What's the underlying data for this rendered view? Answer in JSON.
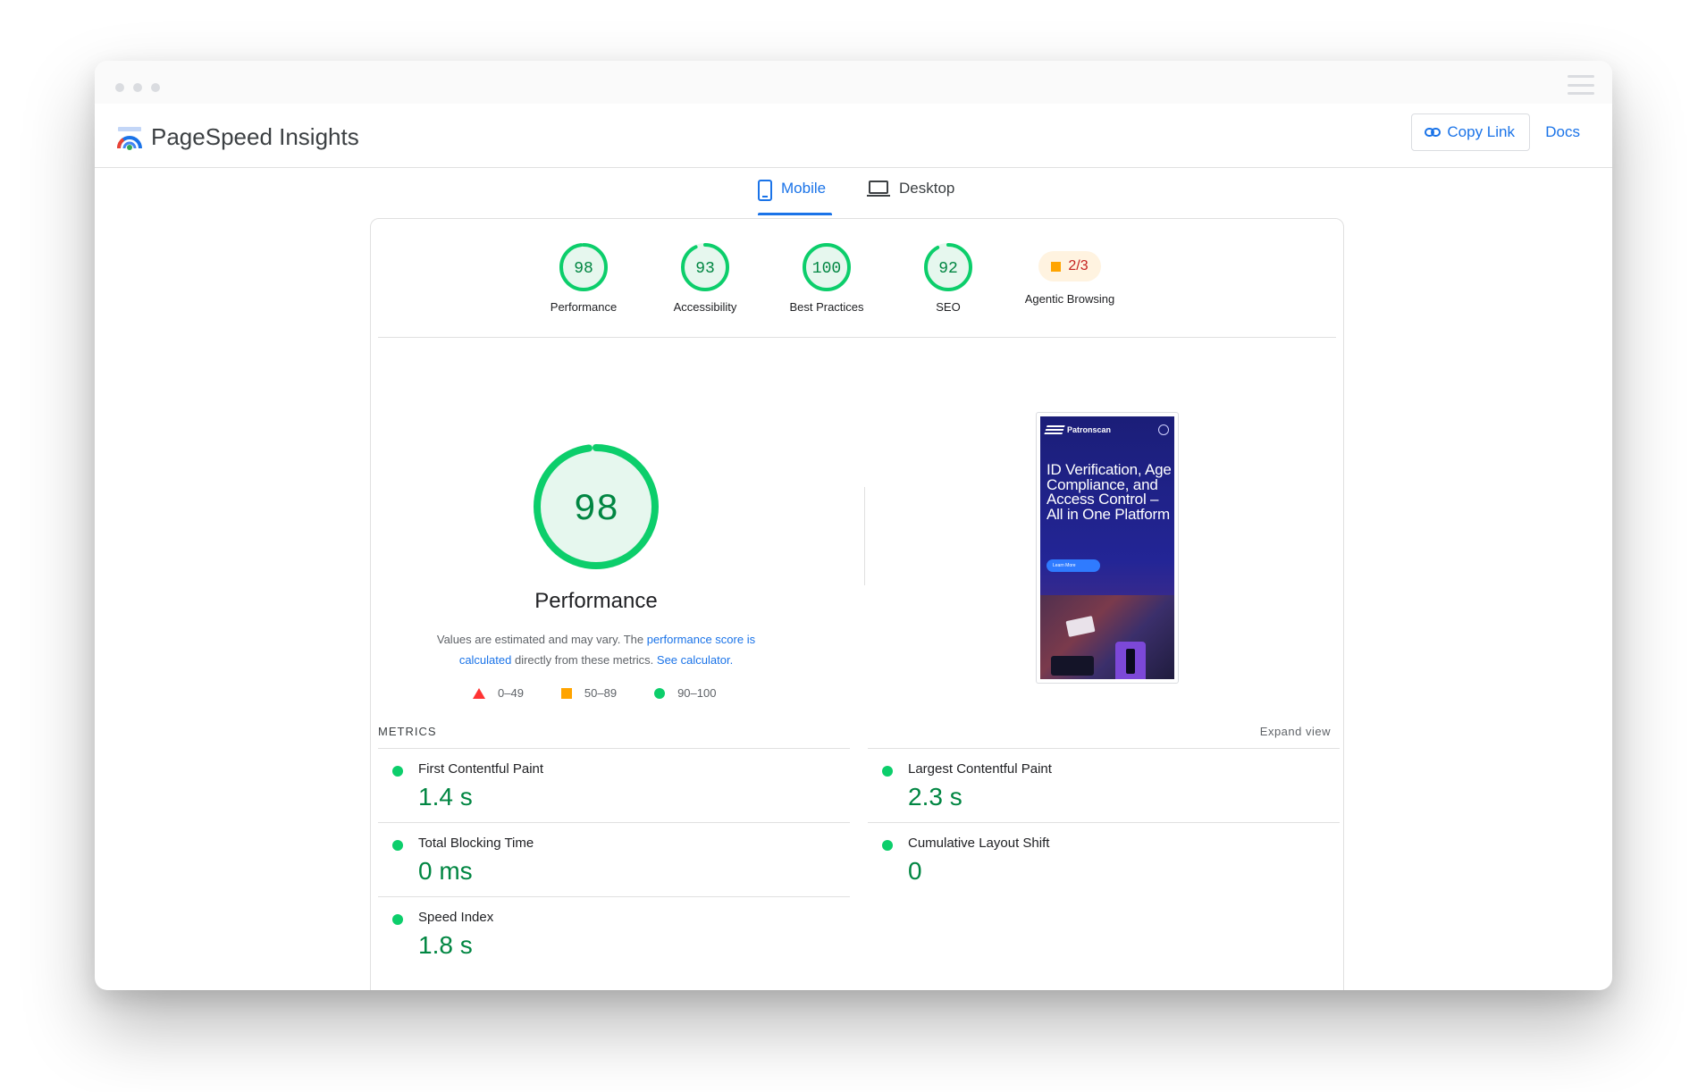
{
  "app": {
    "title": "PageSpeed Insights"
  },
  "header": {
    "copy_link_label": "Copy Link",
    "docs_label": "Docs"
  },
  "tabs": [
    {
      "label": "Mobile",
      "active": true
    },
    {
      "label": "Desktop",
      "active": false
    }
  ],
  "scores": [
    {
      "label": "Performance",
      "value": "98",
      "score": 0.98
    },
    {
      "label": "Accessibility",
      "value": "93",
      "score": 0.93
    },
    {
      "label": "Best Practices",
      "value": "100",
      "score": 1.0
    },
    {
      "label": "SEO",
      "value": "92",
      "score": 0.92
    },
    {
      "label": "Agentic Browsing",
      "value": "2/3"
    }
  ],
  "performance": {
    "score": "98",
    "score_fraction": 0.98,
    "title": "Performance",
    "desc_1": "Values are estimated and may vary. The ",
    "desc_link_1": "performance score is calculated",
    "desc_2": " directly from these metrics. ",
    "desc_link_2": "See calculator."
  },
  "legend": [
    {
      "shape": "triangle",
      "color": "#ff3333",
      "label": "0–49"
    },
    {
      "shape": "square",
      "color": "#ffa400",
      "label": "50–89"
    },
    {
      "shape": "circle",
      "color": "#0cce6b",
      "label": "90–100"
    }
  ],
  "screenshot": {
    "brand": "Patronscan",
    "headline": "ID Verification, Age Compliance, and Access Control – All in One Platform",
    "cta": "Learn More"
  },
  "metrics": {
    "heading": "METRICS",
    "expand_label": "Expand view",
    "left": [
      {
        "name": "First Contentful Paint",
        "value": "1.4 s"
      },
      {
        "name": "Total Blocking Time",
        "value": "0 ms"
      },
      {
        "name": "Speed Index",
        "value": "1.8 s"
      }
    ],
    "right": [
      {
        "name": "Largest Contentful Paint",
        "value": "2.3 s"
      },
      {
        "name": "Cumulative Layout Shift",
        "value": "0"
      }
    ]
  },
  "colors": {
    "pass_green": "#0cce6b",
    "pass_text": "#018642",
    "gauge_fill": "#e6f7ee",
    "accent_blue": "#1a73e8"
  }
}
